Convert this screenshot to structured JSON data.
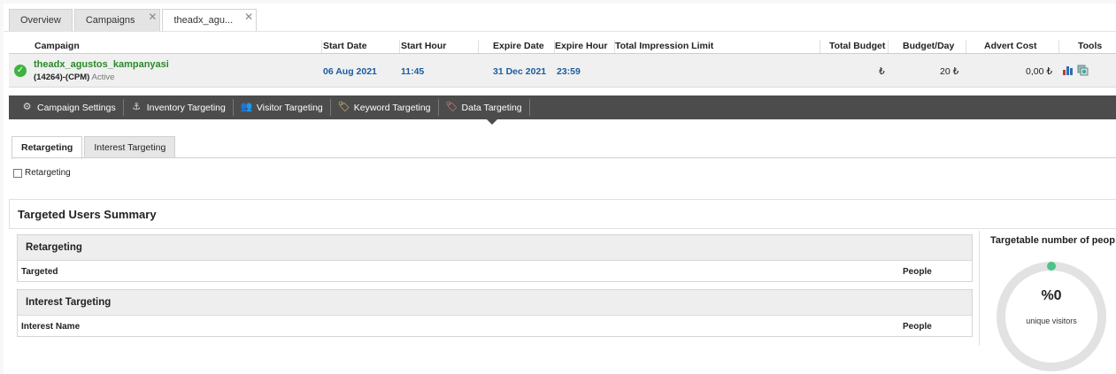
{
  "tabs": [
    {
      "label": "Overview",
      "closable": false
    },
    {
      "label": "Campaigns",
      "closable": true
    },
    {
      "label": "theadx_agu...",
      "closable": true
    }
  ],
  "table": {
    "headers": {
      "campaign": "Campaign",
      "start_date": "Start Date",
      "start_hour": "Start Hour",
      "expire_date": "Expire Date",
      "expire_hour": "Expire Hour",
      "impression_limit": "Total Impression Limit",
      "total_budget": "Total Budget",
      "budget_day": "Budget/Day",
      "advert_cost": "Advert Cost",
      "tools": "Tools"
    },
    "row": {
      "name": "theadx_agustos_kampanyasi",
      "id_type": "(14264)-(CPM)",
      "status": "Active",
      "start_date": "06 Aug 2021",
      "start_hour": "11:45",
      "expire_date": "31 Dec 2021",
      "expire_hour": "23:59",
      "impression_limit": "",
      "total_budget": "₺",
      "budget_day": "20 ₺",
      "advert_cost": "0,00 ₺"
    }
  },
  "toolbar": {
    "items": [
      {
        "label": "Campaign Settings",
        "icon": "gear-icon"
      },
      {
        "label": "Inventory Targeting",
        "icon": "anchor-icon"
      },
      {
        "label": "Visitor Targeting",
        "icon": "users-icon"
      },
      {
        "label": "Keyword Targeting",
        "icon": "tag-icon"
      },
      {
        "label": "Data Targeting",
        "icon": "tag-icon"
      }
    ]
  },
  "subtabs": [
    "Retargeting",
    "Interest Targeting"
  ],
  "retargeting_checkbox": {
    "label": "Retargeting",
    "checked": false
  },
  "summary": {
    "title": "Targeted Users Summary",
    "retargeting": {
      "title": "Retargeting",
      "col1": "Targeted",
      "col2": "People"
    },
    "interest": {
      "title": "Interest Targeting",
      "col1": "Interest Name",
      "col2": "People"
    },
    "targetable": {
      "title": "Targetable number of peop",
      "percent": "%0",
      "caption": "unique visitors",
      "value": 0
    }
  },
  "colors": {
    "accent_green": "#3fb33f",
    "link_blue": "#1b5c9e",
    "toolbar_bg": "#4c4c4c"
  }
}
